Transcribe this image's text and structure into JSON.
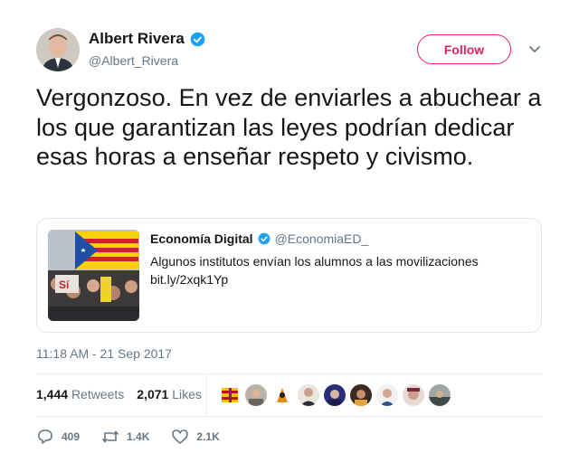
{
  "author": {
    "name": "Albert Rivera",
    "handle": "@Albert_Rivera",
    "follow_label": "Follow"
  },
  "tweet": {
    "text": "Vergonzoso. En vez de enviarles a abuchear a los que garantizan las leyes podrían dedicar esas horas a enseñar respeto y civismo.",
    "timestamp": "11:18 AM - 21 Sep 2017"
  },
  "quote": {
    "name": "Economía Digital",
    "handle": "@EconomiaED_",
    "text": "Algunos institutos envían los alumnos a las movilizaciones",
    "link": "bit.ly/2xqk1Yp"
  },
  "stats": {
    "retweets_count": "1,444",
    "retweets_label": "Retweets",
    "likes_count": "2,071",
    "likes_label": "Likes"
  },
  "actions": {
    "replies": "409",
    "retweets": "1.4K",
    "likes": "2.1K"
  },
  "colors": {
    "brand_blue": "#1da1f2",
    "follow_red": "#e0245e",
    "muted": "#657786"
  },
  "icons": [
    "verified-badge-icon",
    "chevron-down-icon",
    "reply-icon",
    "retweet-icon",
    "heart-icon"
  ]
}
